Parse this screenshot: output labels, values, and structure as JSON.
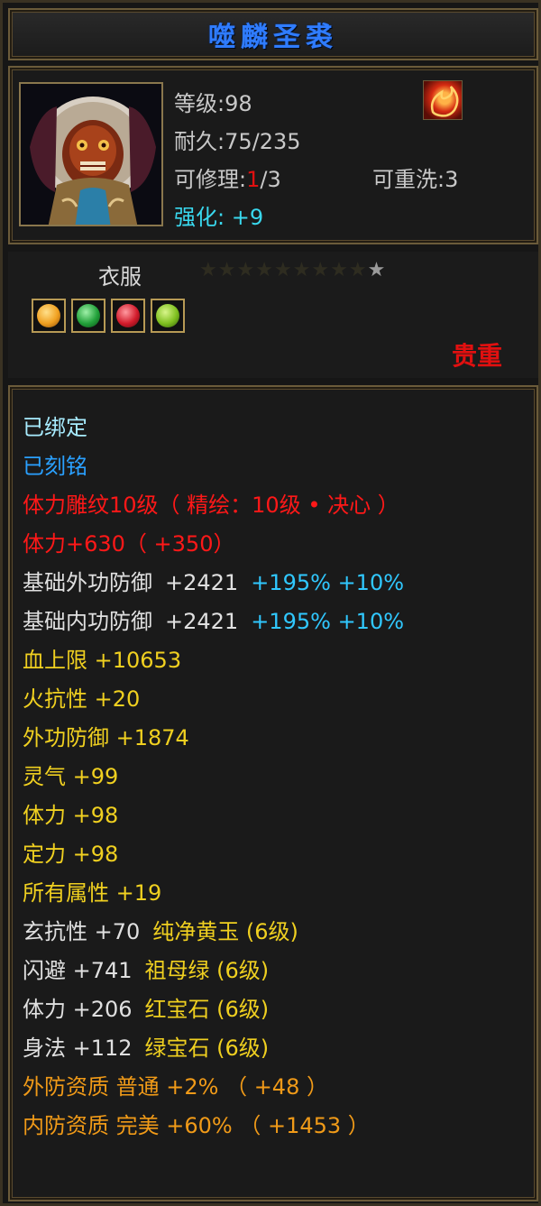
{
  "title": "噬麟圣裘",
  "item": {
    "level_label": "等级:",
    "level_value": "98",
    "durability_label": "耐久:",
    "durability_value": "75/235",
    "repair_label": "可修理:",
    "repair_used": "1",
    "repair_total": "/3",
    "rewash_label": "可重洗:",
    "rewash_value": "3",
    "enhance_label": "强化:",
    "enhance_value": "+9"
  },
  "type": {
    "label": "衣服",
    "stars_total": 10,
    "quality": "贵重"
  },
  "gems": [
    {
      "name": "yellow-gem",
      "color": "#f0a020"
    },
    {
      "name": "green-gem",
      "color": "#22a13a"
    },
    {
      "name": "red-gem",
      "color": "#d21b2b"
    },
    {
      "name": "lime-gem",
      "color": "#7fbf1f"
    }
  ],
  "attributes": {
    "bound": "已绑定",
    "engraved": "已刻铭",
    "carving": "体力雕纹10级（ 精绘：10级 • 决心 ）",
    "stamina_bonus": "体力+630（ +350）",
    "ext_def_label": "基础外功防御",
    "ext_def_value": "+2421",
    "ext_def_pct1": "+195%",
    "ext_def_pct2": "+10%",
    "int_def_label": "基础内功防御",
    "int_def_value": "+2421",
    "int_def_pct1": "+195%",
    "int_def_pct2": "+10%",
    "hp": "血上限  +10653",
    "fire_res": "火抗性  +20",
    "ext_defense": "外功防御  +1874",
    "spirit": "灵气  +99",
    "stamina": "体力  +98",
    "focus": "定力  +98",
    "all_attr": "所有属性  +19",
    "gem_lines": [
      {
        "stat": "玄抗性  +70",
        "gem": "纯净黄玉 (6级)"
      },
      {
        "stat": "闪避  +741",
        "gem": "祖母绿 (6级)"
      },
      {
        "stat": "体力  +206",
        "gem": "红宝石 (6级)"
      },
      {
        "stat": "身法  +112",
        "gem": "绿宝石 (6级)"
      }
    ],
    "ext_aptitude": "外防资质   普通  +2% （ +48 ）",
    "int_aptitude": "内防资质   完美  +60% （ +1453 ）"
  }
}
